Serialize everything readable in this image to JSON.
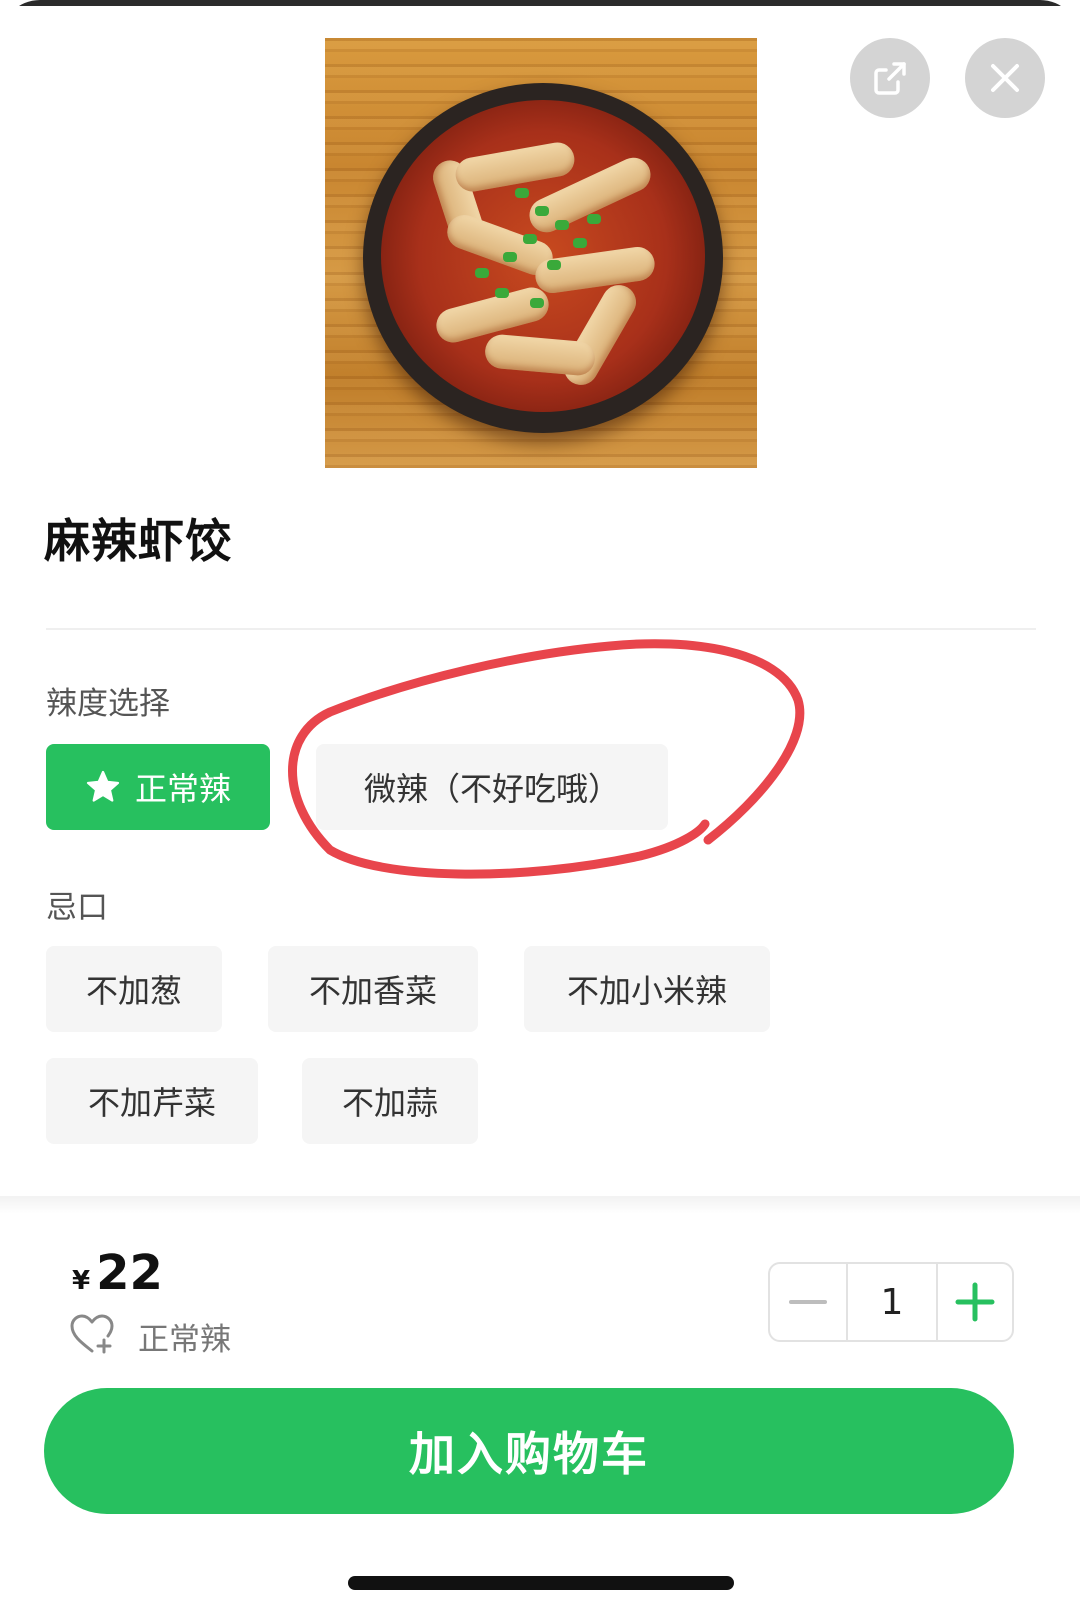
{
  "product": {
    "title": "麻辣虾饺",
    "image_icon": "dish-photo"
  },
  "header": {
    "share_icon": "share-icon",
    "close_icon": "close-icon"
  },
  "spice": {
    "label": "辣度选择",
    "options": [
      {
        "label": "正常辣",
        "selected": true,
        "icon": "star-icon"
      },
      {
        "label": "微辣（不好吃哦）",
        "selected": false
      }
    ]
  },
  "avoid": {
    "label": "忌口",
    "options": [
      "不加葱",
      "不加香菜",
      "不加小米辣",
      "不加芹菜",
      "不加蒜"
    ]
  },
  "footer": {
    "currency": "¥",
    "price": "22",
    "selected_spec": "正常辣",
    "quantity": "1",
    "add_to_cart": "加入购物车"
  },
  "colors": {
    "accent": "#27c05f",
    "annotation": "#e8454c"
  }
}
